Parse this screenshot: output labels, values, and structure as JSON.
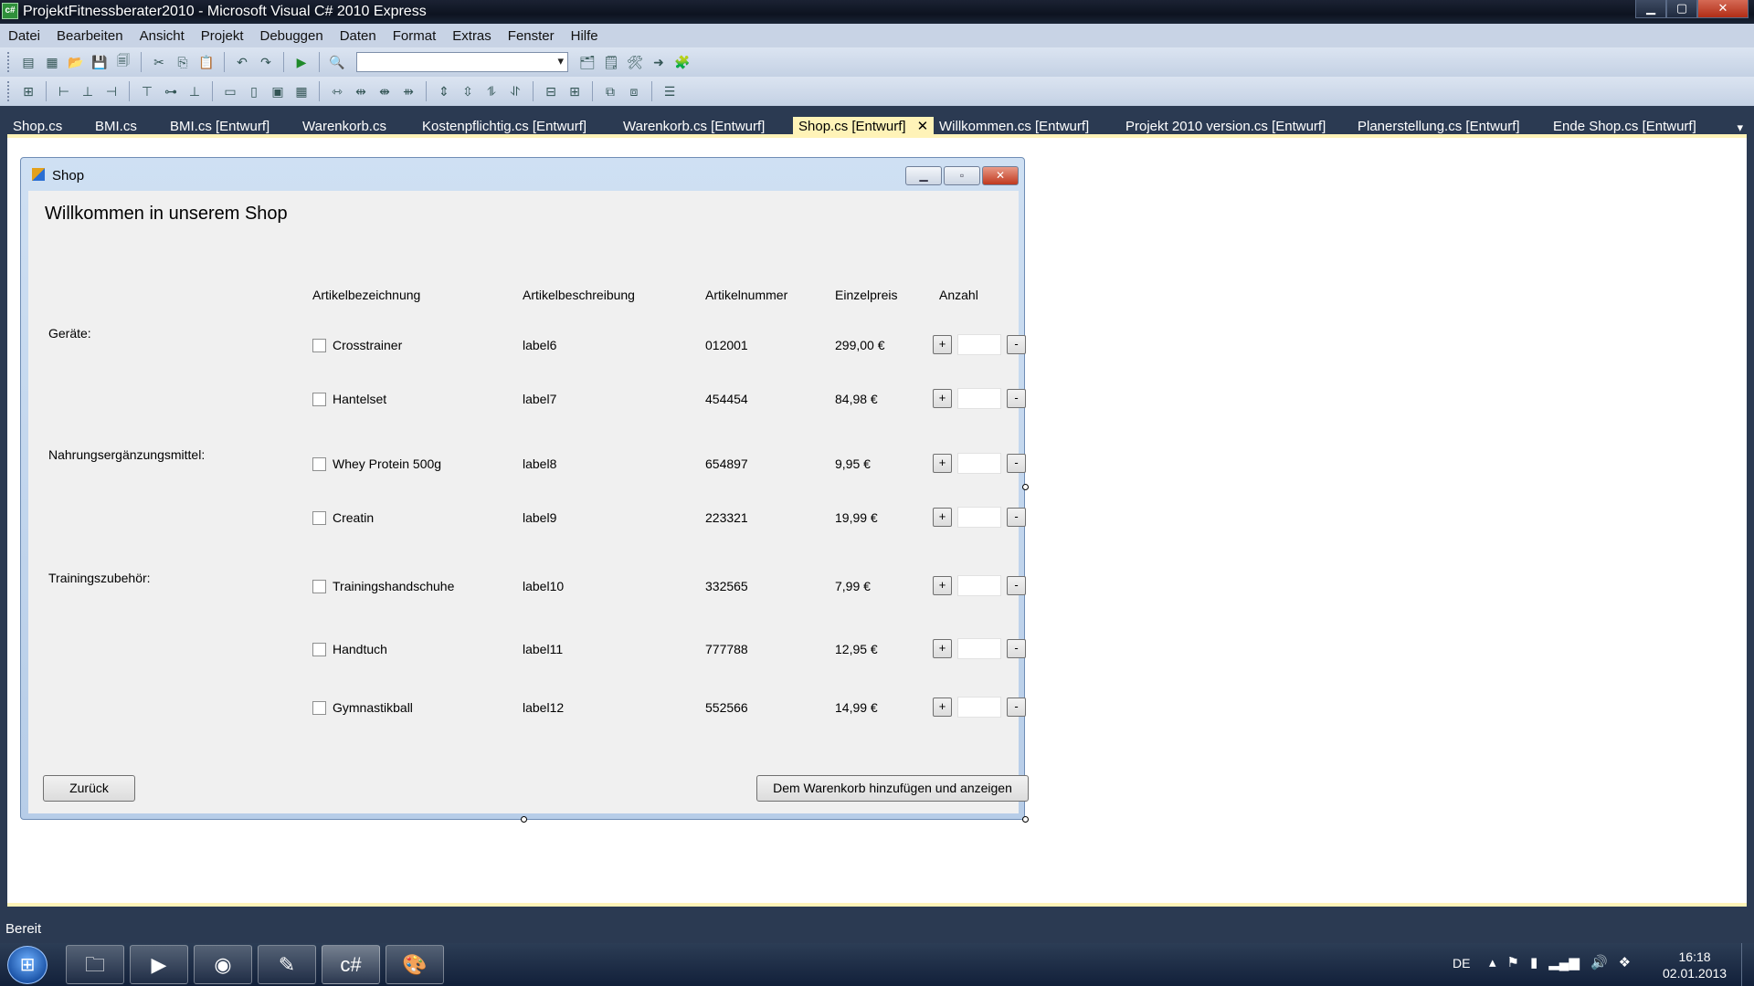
{
  "window": {
    "app_icon": "c#",
    "title": "ProjektFitnessberater2010 - Microsoft Visual C# 2010 Express",
    "minimize": "▁",
    "maximize": "▢",
    "close": "✕"
  },
  "menu": [
    "Datei",
    "Bearbeiten",
    "Ansicht",
    "Projekt",
    "Debuggen",
    "Daten",
    "Format",
    "Extras",
    "Fenster",
    "Hilfe"
  ],
  "toolbar": {
    "config_combo_value": ""
  },
  "tabs": [
    {
      "label": "Shop.cs",
      "active": false
    },
    {
      "label": "BMI.cs",
      "active": false
    },
    {
      "label": "BMI.cs [Entwurf]",
      "active": false
    },
    {
      "label": "Warenkorb.cs",
      "active": false
    },
    {
      "label": "Kostenpflichtig.cs [Entwurf]",
      "active": false
    },
    {
      "label": "Warenkorb.cs [Entwurf]",
      "active": false
    },
    {
      "label": "Shop.cs [Entwurf]",
      "active": true,
      "close": "✕"
    },
    {
      "label": "Willkommen.cs [Entwurf]",
      "active": false
    },
    {
      "label": "Projekt 2010 version.cs [Entwurf]",
      "active": false
    },
    {
      "label": "Planerstellung.cs [Entwurf]",
      "active": false
    },
    {
      "label": "Ende Shop.cs [Entwurf]",
      "active": false
    }
  ],
  "tab_overflow": "▾",
  "form": {
    "title": "Shop",
    "min": "▁",
    "max": "▫",
    "close": "✕",
    "welcome": "Willkommen in unserem Shop",
    "headers": {
      "name": "Artikelbezeichnung",
      "description": "Artikelbeschreibung",
      "number": "Artikelnummer",
      "price": "Einzelpreis",
      "quantity": "Anzahl"
    },
    "categories": [
      "Geräte:",
      "Nahrungsergänzungsmittel:",
      "Trainingszubehör:"
    ],
    "products": [
      {
        "name": "Crosstrainer",
        "description": "label6",
        "number": "012001",
        "price": "299,00 €",
        "checked": false,
        "quantity": ""
      },
      {
        "name": "Hantelset",
        "description": "label7",
        "number": "454454",
        "price": "84,98 €",
        "checked": false,
        "quantity": ""
      },
      {
        "name": "Whey Protein 500g",
        "description": "label8",
        "number": "654897",
        "price": "9,95 €",
        "checked": false,
        "quantity": ""
      },
      {
        "name": "Creatin",
        "description": "label9",
        "number": "223321",
        "price": "19,99 €",
        "checked": false,
        "quantity": ""
      },
      {
        "name": "Trainingshandschuhe",
        "description": "label10",
        "number": "332565",
        "price": "7,99 €",
        "checked": false,
        "quantity": ""
      },
      {
        "name": "Handtuch",
        "description": "label11",
        "number": "777788",
        "price": "12,95 €",
        "checked": false,
        "quantity": ""
      },
      {
        "name": "Gymnastikball",
        "description": "label12",
        "number": "552566",
        "price": "14,99 €",
        "checked": false,
        "quantity": ""
      }
    ],
    "plus_label": "+",
    "minus_label": "-",
    "back_button": "Zurück",
    "cart_button": "Dem Warenkorb hinzufügen und anzeigen"
  },
  "status": {
    "text": "Bereit"
  },
  "taskbar": {
    "start_icon": "windows-start-icon",
    "apps": [
      "explorer-folder-icon",
      "media-player-icon",
      "firefox-icon",
      "notepad-icon",
      "visual-csharp-icon",
      "paint-icon"
    ],
    "language": "DE",
    "time": "16:18",
    "date": "02.01.2013"
  }
}
